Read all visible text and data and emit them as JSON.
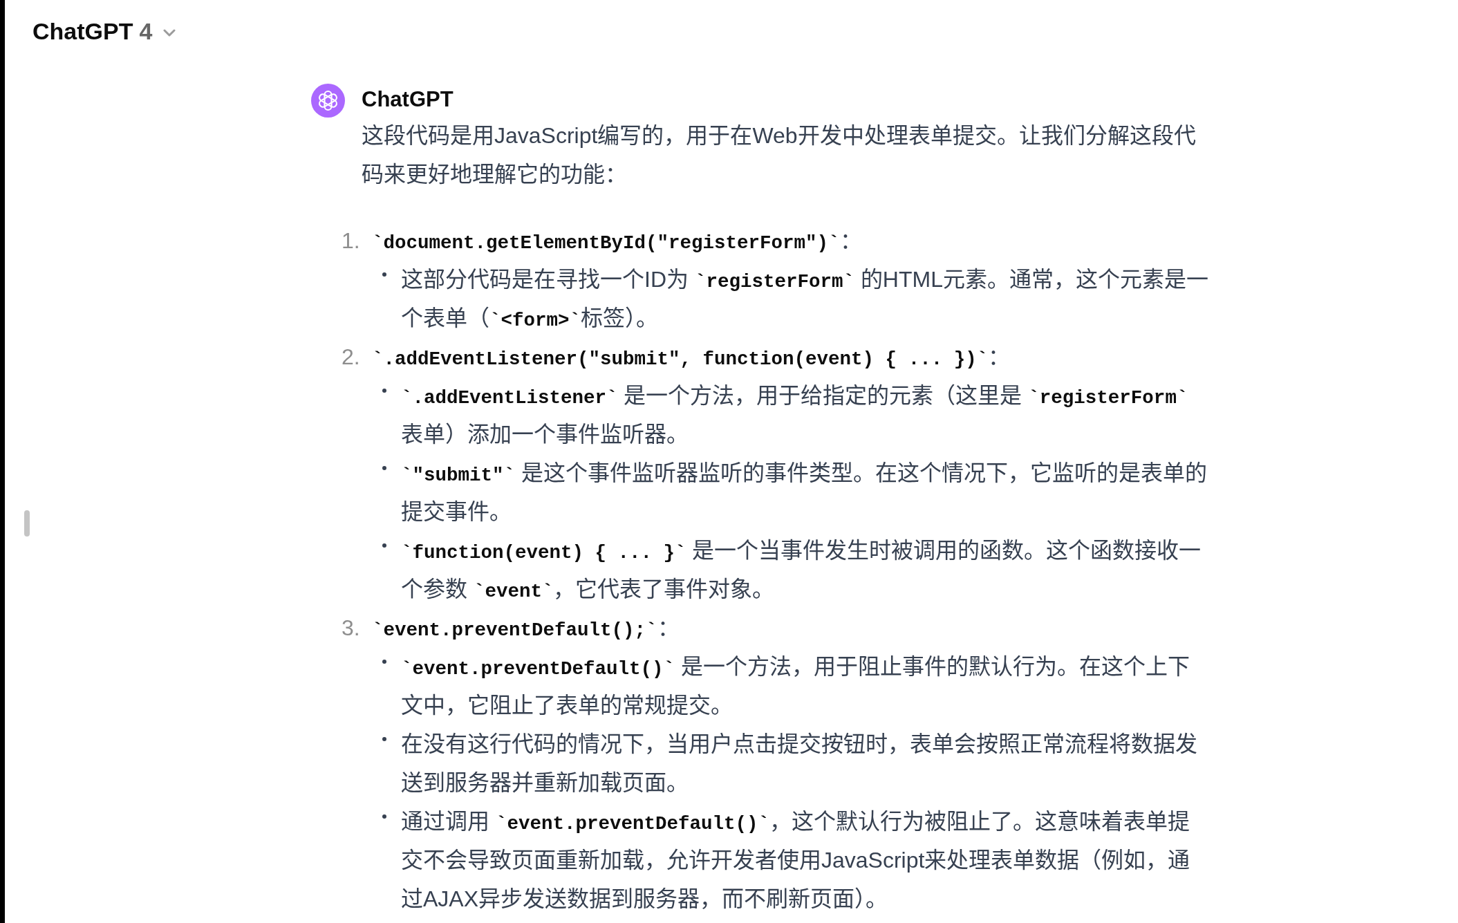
{
  "header": {
    "model_name": "ChatGPT",
    "model_version": "4"
  },
  "message": {
    "author": "ChatGPT",
    "intro": "这段代码是用JavaScript编写的，用于在Web开发中处理表单提交。让我们分解这段代码来更好地理解它的功能：",
    "items": [
      {
        "number": "1.",
        "title": "**`document.getElementById(\"registerForm\")`**：",
        "bullets": [
          "这部分代码是在寻找一个ID为 **`registerForm`** 的HTML元素。通常，这个元素是一个表单（**`<form>`**标签）。"
        ]
      },
      {
        "number": "2.",
        "title": "**`.addEventListener(\"submit\", function(event) { ... })`**：",
        "bullets": [
          "**`.addEventListener`** 是一个方法，用于给指定的元素（这里是 **`registerForm`** 表单）添加一个事件监听器。",
          "**`\"submit\"`** 是这个事件监听器监听的事件类型。在这个情况下，它监听的是表单的提交事件。",
          "**`function(event) { ... }`** 是一个当事件发生时被调用的函数。这个函数接收一个参数 **`event`**，它代表了事件对象。"
        ]
      },
      {
        "number": "3.",
        "title": "**`event.preventDefault();`**：",
        "bullets": [
          "**`event.preventDefault()`** 是一个方法，用于阻止事件的默认行为。在这个上下文中，它阻止了表单的常规提交。",
          "在没有这行代码的情况下，当用户点击提交按钮时，表单会按照正常流程将数据发送到服务器并重新加载页面。",
          "通过调用 **`event.preventDefault()`**，这个默认行为被阻止了。这意味着表单提交不会导致页面重新加载，允许开发者使用JavaScript来处理表单数据（例如，通过AJAX异步发送数据到服务器，而不刷新页面）。"
        ]
      }
    ]
  }
}
